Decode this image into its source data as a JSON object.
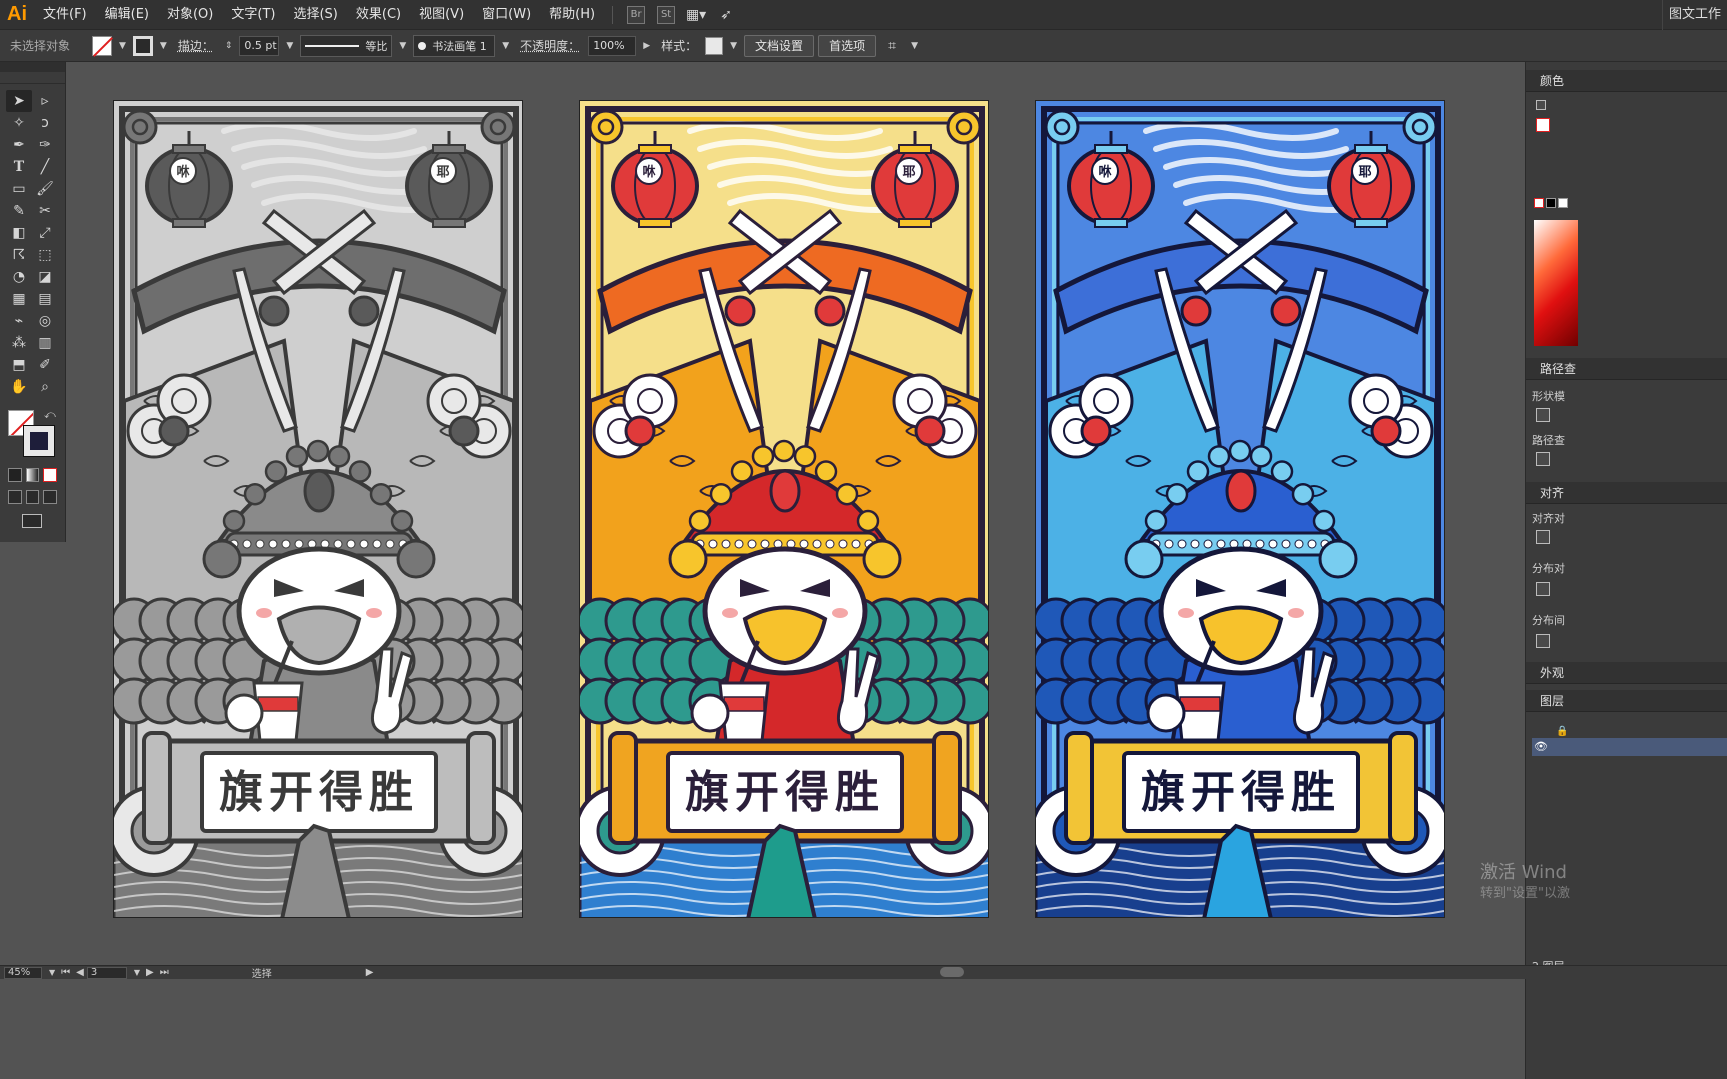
{
  "app": {
    "logo": "Ai",
    "workspace": "图文工作"
  },
  "menu": [
    "文件(F)",
    "编辑(E)",
    "对象(O)",
    "文字(T)",
    "选择(S)",
    "效果(C)",
    "视图(V)",
    "窗口(W)",
    "帮助(H)"
  ],
  "menu_badges": [
    "Br",
    "St"
  ],
  "control": {
    "selection": "未选择对象",
    "stroke_label": "描边：",
    "stroke_value": "0.5 pt",
    "profile": "等比",
    "brush": "书法画笔 1",
    "opacity_label": "不透明度：",
    "opacity_value": "100%",
    "style_label": "样式：",
    "doc_setup": "文档设置",
    "prefs": "首选项"
  },
  "panels": {
    "color": "颜色",
    "pathfinder": "路径查",
    "shape_modes": "形状模",
    "pathfinders": "路径查",
    "align": "对齐",
    "align_objects": "对齐对",
    "distribute_objects": "分布对",
    "distribute_spacing": "分布间",
    "appearance": "外观",
    "layers": "图层",
    "layers_count": "2 图层"
  },
  "artboards": [
    {
      "title": "旗开得胜",
      "lantern_left": "咻",
      "lantern_right": "耶",
      "theme": "grayscale"
    },
    {
      "title": "旗开得胜",
      "lantern_left": "咻",
      "lantern_right": "耶",
      "theme": "gold"
    },
    {
      "title": "旗开得胜",
      "lantern_left": "咻",
      "lantern_right": "耶",
      "theme": "blue"
    }
  ],
  "themes": {
    "grayscale": {
      "bg": "#cfcfcf",
      "frame": "#3a3a3a",
      "banner": "#6e6e6e",
      "flag": "#b8b8b8",
      "lantern": "#5a5a5a",
      "crown": "#8a8a8a",
      "wave": "#9a9a9a",
      "sea": "#7a7a7a",
      "scroll": "#bdbdbd",
      "mount": "#8c8c8c",
      "cloud": "#e8e8e8",
      "accent": "#777777",
      "beak": "#b0b0b0"
    },
    "gold": {
      "bg": "#f5df8a",
      "frame": "#2b1f3a",
      "banner": "#ee6a22",
      "flag": "#f2a21c",
      "lantern": "#e03a3a",
      "crown": "#d4282a",
      "wave": "#2e9a8e",
      "sea": "#2f7fcf",
      "scroll": "#f0a420",
      "mount": "#1e9c8c",
      "cloud": "#ffffff",
      "accent": "#f7c52c",
      "beak": "#f7c22c"
    },
    "blue": {
      "bg": "#4d87e2",
      "frame": "#14173a",
      "banner": "#3d6fd8",
      "flag": "#4cb1e6",
      "lantern": "#e03a3a",
      "crown": "#2a5fd0",
      "wave": "#1f58b8",
      "sea": "#183f8e",
      "scroll": "#f2c436",
      "mount": "#2aa4e0",
      "cloud": "#ffffff",
      "accent": "#78cdf0",
      "beak": "#f7c22c"
    }
  },
  "status": {
    "zoom": "45%",
    "page": "3",
    "tool": "选择"
  },
  "watermark": {
    "line1": "激活 Wind",
    "line2": "转到\"设置\"以激"
  }
}
